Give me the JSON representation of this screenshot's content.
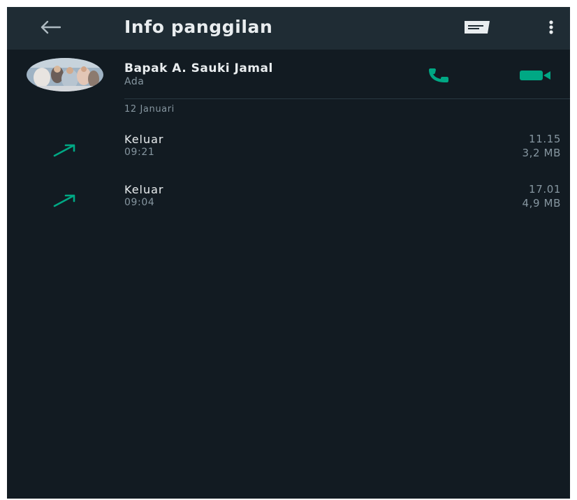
{
  "header": {
    "title": "Info panggilan",
    "back_icon": "arrow-left-icon",
    "message_icon": "message-icon",
    "more_icon": "more-vertical-icon"
  },
  "contact": {
    "name": "Bapak A. Sauki Jamal",
    "status": "Ada",
    "voice_call_icon": "phone-icon",
    "video_call_icon": "videocam-icon"
  },
  "call_log": {
    "date": "12 Januari",
    "calls": [
      {
        "type": "Keluar",
        "time": "09:21",
        "duration": "11.15",
        "size": "3,2 MB",
        "direction_icon": "outgoing-arrow-icon"
      },
      {
        "type": "Keluar",
        "time": "09:04",
        "duration": "17.01",
        "size": "4,9 MB",
        "direction_icon": "outgoing-arrow-icon"
      }
    ]
  },
  "colors": {
    "background": "#121b22",
    "appbar": "#1f2c34",
    "accent": "#00a884",
    "primary_text": "#e9edef",
    "secondary_text": "#8696a0"
  }
}
